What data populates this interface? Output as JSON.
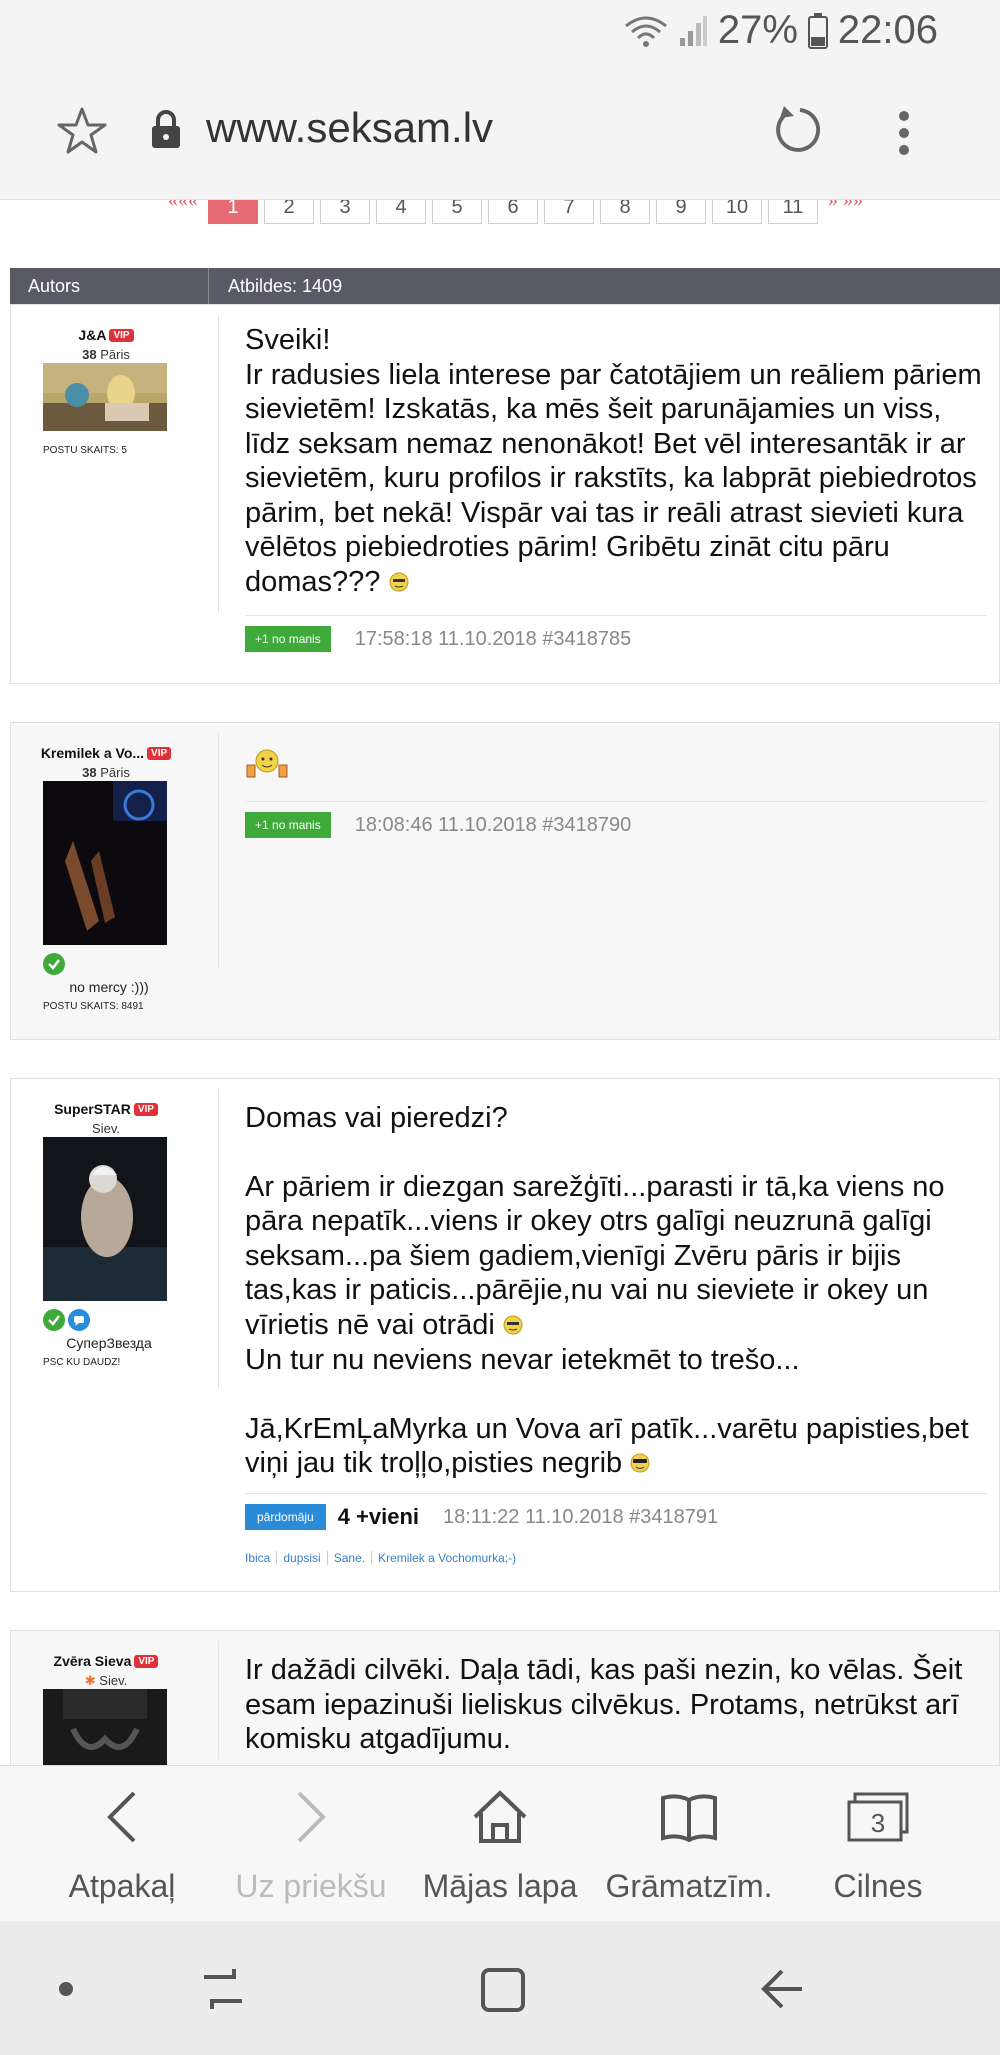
{
  "status_bar": {
    "battery": "27%",
    "time": "22:06",
    "icons": [
      "wifi-icon",
      "signal-icon",
      "battery-icon"
    ]
  },
  "browser": {
    "url": "www.seksam.lv",
    "icons": [
      "star-icon",
      "lock-icon",
      "reload-icon",
      "more-menu-icon"
    ]
  },
  "pagination": {
    "prev": "«««",
    "pages": [
      "1",
      "2",
      "3",
      "4",
      "5",
      "6",
      "7",
      "8",
      "9",
      "10",
      "11"
    ],
    "current": "1",
    "next": "» »»"
  },
  "thread_header": {
    "author_col": "Autors",
    "replies_col": "Atbildes: 1409"
  },
  "posts": [
    {
      "author": "J&A",
      "vip": "VIP",
      "age": "38",
      "type": "Pāris",
      "post_count": "POSTU SKAITS: 5",
      "text": [
        "Sveiki!",
        "Ir radusies liela interese par čatotājiem un reāliem pāriem sievietēm! Izskatās, ka mēs šeit parunājamies un viss, līdz seksam nemaz nenonākot! Bet vēl interesantāk ir ar sievietēm, kuru profilos ir rakstīts, ka labprāt piebiedrotos pārim, bet nekā! Vispār vai tas ir reāli atrast sievieti kura vēlētos piebiedroties pārim! Gribētu zināt citu pāru domas???"
      ],
      "button": "+1 no manis",
      "timestamp": "17:58:18 11.10.2018 #3418785"
    },
    {
      "author": "Kremilek a Vo...",
      "vip": "VIP",
      "age": "38",
      "type": "Pāris",
      "motto": "no mercy :)))",
      "post_count": "POSTU SKAITS: 8491",
      "button": "+1 no manis",
      "timestamp": "18:08:46 11.10.2018 #3418790"
    },
    {
      "author": "SuperSTAR",
      "vip": "VIP",
      "type": "Siev.",
      "motto": "СуперЗвезда",
      "post_count": "PSC KU DAUDZ!",
      "text": [
        "Domas vai pieredzi?",
        "Ar pāriem ir diezgan sarežģīti...parasti ir tā,ka viens no pāra nepatīk...viens ir okey otrs galīgi neuzrunā galīgi seksam...pa šiem gadiem,vienīgi Zvēru pāris ir bijis tas,kas ir paticis...pārējie,nu vai nu sieviete ir okey un vīrietis nē vai otrādi",
        "Un tur nu neviens nevar ietekmēt to trešo...",
        "Jā,KrEmĻaMyrka un Vova arī patīk...varētu papisties,bet viņi jau tik troļļo,pisties negrib"
      ],
      "button": "pārdomāju",
      "plus": "4 +vieni",
      "timestamp": "18:11:22 11.10.2018 #3418791",
      "likers": [
        "Ibica",
        "dupsisi",
        "Sane.",
        "Kremilek a Vochomurka;-)"
      ]
    },
    {
      "author": "Zvēra Sieva",
      "vip": "VIP",
      "type": "Siev.",
      "text": [
        "Ir dažādi cilvēki. Daļa tādi, kas paši nezin, ko vēlas. Šeit esam iepazinuši lieliskus cilvēkus. Protams, netrūkst arī komisku atgadījumu."
      ]
    }
  ],
  "bottom_nav": [
    {
      "label": "Atpakaļ",
      "icon": "back-icon",
      "enabled": true
    },
    {
      "label": "Uz priekšu",
      "icon": "forward-icon",
      "enabled": false
    },
    {
      "label": "Mājas lapa",
      "icon": "home-icon",
      "enabled": true
    },
    {
      "label": "Grāmatzīm.",
      "icon": "bookmarks-icon",
      "enabled": true
    },
    {
      "label": "Cilnes",
      "icon": "tabs-icon",
      "enabled": true,
      "count": "3"
    }
  ],
  "colors": {
    "accent_page": "#e86a75",
    "header_bar": "#5a5a66",
    "button_green": "#3faa3a",
    "button_blue": "#2a8bd8",
    "vip_red": "#e0303a"
  }
}
